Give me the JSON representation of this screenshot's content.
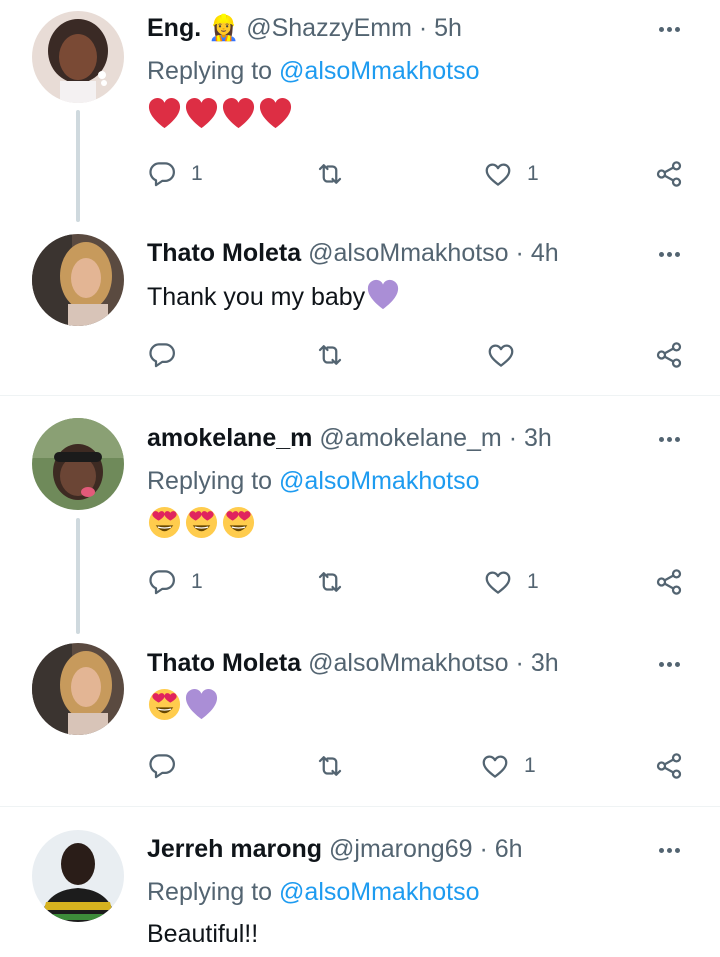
{
  "tweets": [
    {
      "name": "Eng. 👷‍♀️",
      "handle": "@ShazzyEmm",
      "dot": "·",
      "time": "5h",
      "replying_prefix": "Replying to",
      "replying_to": "@alsoMmakhotso",
      "emojis": [
        "red-heart",
        "red-heart",
        "red-heart",
        "red-heart"
      ],
      "reply_count": "1",
      "retweet_count": "",
      "like_count": "1"
    },
    {
      "name": "Thato Moleta",
      "handle": "@alsoMmakhotso",
      "dot": "·",
      "time": "4h",
      "text": "Thank you my baby",
      "emojis": [
        "purple-heart"
      ],
      "reply_count": "",
      "retweet_count": "",
      "like_count": ""
    },
    {
      "name": "amokelane_m",
      "handle": "@amokelane_m",
      "dot": "·",
      "time": "3h",
      "replying_prefix": "Replying to",
      "replying_to": "@alsoMmakhotso",
      "emojis": [
        "heart-eyes-face",
        "heart-eyes-face",
        "heart-eyes-face"
      ],
      "reply_count": "1",
      "retweet_count": "",
      "like_count": "1"
    },
    {
      "name": "Thato Moleta",
      "handle": "@alsoMmakhotso",
      "dot": "·",
      "time": "3h",
      "emojis": [
        "heart-eyes-face",
        "purple-heart"
      ],
      "reply_count": "",
      "retweet_count": "",
      "like_count": "1"
    },
    {
      "name": "Jerreh marong",
      "handle": "@jmarong69",
      "dot": "·",
      "time": "6h",
      "replying_prefix": "Replying to",
      "replying_to": "@alsoMmakhotso",
      "text": "Beautiful!!"
    }
  ],
  "colors": {
    "text": "#0f1419",
    "muted": "#536471",
    "link": "#1d9bf0",
    "thread_line": "#cfd9de",
    "red_heart": "#dd2e44",
    "purple_heart": "#aa8ed6"
  },
  "icons": [
    "reply-icon",
    "retweet-icon",
    "like-icon",
    "share-icon",
    "more-icon"
  ]
}
